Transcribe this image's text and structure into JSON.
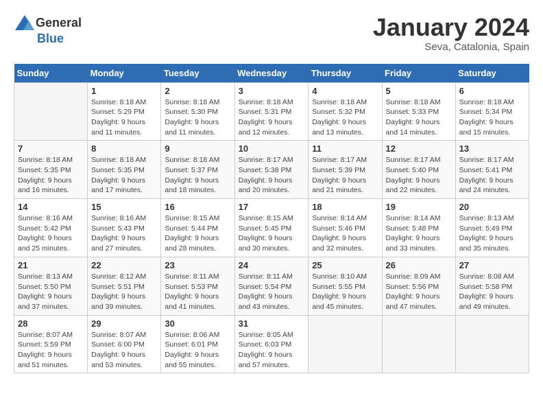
{
  "logo": {
    "general": "General",
    "blue": "Blue"
  },
  "title": "January 2024",
  "subtitle": "Seva, Catalonia, Spain",
  "days_header": [
    "Sunday",
    "Monday",
    "Tuesday",
    "Wednesday",
    "Thursday",
    "Friday",
    "Saturday"
  ],
  "weeks": [
    [
      {
        "day": "",
        "info": ""
      },
      {
        "day": "1",
        "info": "Sunrise: 8:18 AM\nSunset: 5:29 PM\nDaylight: 9 hours\nand 11 minutes."
      },
      {
        "day": "2",
        "info": "Sunrise: 8:18 AM\nSunset: 5:30 PM\nDaylight: 9 hours\nand 11 minutes."
      },
      {
        "day": "3",
        "info": "Sunrise: 8:18 AM\nSunset: 5:31 PM\nDaylight: 9 hours\nand 12 minutes."
      },
      {
        "day": "4",
        "info": "Sunrise: 8:18 AM\nSunset: 5:32 PM\nDaylight: 9 hours\nand 13 minutes."
      },
      {
        "day": "5",
        "info": "Sunrise: 8:18 AM\nSunset: 5:33 PM\nDaylight: 9 hours\nand 14 minutes."
      },
      {
        "day": "6",
        "info": "Sunrise: 8:18 AM\nSunset: 5:34 PM\nDaylight: 9 hours\nand 15 minutes."
      }
    ],
    [
      {
        "day": "7",
        "info": "Sunrise: 8:18 AM\nSunset: 5:35 PM\nDaylight: 9 hours\nand 16 minutes."
      },
      {
        "day": "8",
        "info": "Sunrise: 8:18 AM\nSunset: 5:35 PM\nDaylight: 9 hours\nand 17 minutes."
      },
      {
        "day": "9",
        "info": "Sunrise: 8:18 AM\nSunset: 5:37 PM\nDaylight: 9 hours\nand 18 minutes."
      },
      {
        "day": "10",
        "info": "Sunrise: 8:17 AM\nSunset: 5:38 PM\nDaylight: 9 hours\nand 20 minutes."
      },
      {
        "day": "11",
        "info": "Sunrise: 8:17 AM\nSunset: 5:39 PM\nDaylight: 9 hours\nand 21 minutes."
      },
      {
        "day": "12",
        "info": "Sunrise: 8:17 AM\nSunset: 5:40 PM\nDaylight: 9 hours\nand 22 minutes."
      },
      {
        "day": "13",
        "info": "Sunrise: 8:17 AM\nSunset: 5:41 PM\nDaylight: 9 hours\nand 24 minutes."
      }
    ],
    [
      {
        "day": "14",
        "info": "Sunrise: 8:16 AM\nSunset: 5:42 PM\nDaylight: 9 hours\nand 25 minutes."
      },
      {
        "day": "15",
        "info": "Sunrise: 8:16 AM\nSunset: 5:43 PM\nDaylight: 9 hours\nand 27 minutes."
      },
      {
        "day": "16",
        "info": "Sunrise: 8:15 AM\nSunset: 5:44 PM\nDaylight: 9 hours\nand 28 minutes."
      },
      {
        "day": "17",
        "info": "Sunrise: 8:15 AM\nSunset: 5:45 PM\nDaylight: 9 hours\nand 30 minutes."
      },
      {
        "day": "18",
        "info": "Sunrise: 8:14 AM\nSunset: 5:46 PM\nDaylight: 9 hours\nand 32 minutes."
      },
      {
        "day": "19",
        "info": "Sunrise: 8:14 AM\nSunset: 5:48 PM\nDaylight: 9 hours\nand 33 minutes."
      },
      {
        "day": "20",
        "info": "Sunrise: 8:13 AM\nSunset: 5:49 PM\nDaylight: 9 hours\nand 35 minutes."
      }
    ],
    [
      {
        "day": "21",
        "info": "Sunrise: 8:13 AM\nSunset: 5:50 PM\nDaylight: 9 hours\nand 37 minutes."
      },
      {
        "day": "22",
        "info": "Sunrise: 8:12 AM\nSunset: 5:51 PM\nDaylight: 9 hours\nand 39 minutes."
      },
      {
        "day": "23",
        "info": "Sunrise: 8:11 AM\nSunset: 5:53 PM\nDaylight: 9 hours\nand 41 minutes."
      },
      {
        "day": "24",
        "info": "Sunrise: 8:11 AM\nSunset: 5:54 PM\nDaylight: 9 hours\nand 43 minutes."
      },
      {
        "day": "25",
        "info": "Sunrise: 8:10 AM\nSunset: 5:55 PM\nDaylight: 9 hours\nand 45 minutes."
      },
      {
        "day": "26",
        "info": "Sunrise: 8:09 AM\nSunset: 5:56 PM\nDaylight: 9 hours\nand 47 minutes."
      },
      {
        "day": "27",
        "info": "Sunrise: 8:08 AM\nSunset: 5:58 PM\nDaylight: 9 hours\nand 49 minutes."
      }
    ],
    [
      {
        "day": "28",
        "info": "Sunrise: 8:07 AM\nSunset: 5:59 PM\nDaylight: 9 hours\nand 51 minutes."
      },
      {
        "day": "29",
        "info": "Sunrise: 8:07 AM\nSunset: 6:00 PM\nDaylight: 9 hours\nand 53 minutes."
      },
      {
        "day": "30",
        "info": "Sunrise: 8:06 AM\nSunset: 6:01 PM\nDaylight: 9 hours\nand 55 minutes."
      },
      {
        "day": "31",
        "info": "Sunrise: 8:05 AM\nSunset: 6:03 PM\nDaylight: 9 hours\nand 57 minutes."
      },
      {
        "day": "",
        "info": ""
      },
      {
        "day": "",
        "info": ""
      },
      {
        "day": "",
        "info": ""
      }
    ]
  ]
}
